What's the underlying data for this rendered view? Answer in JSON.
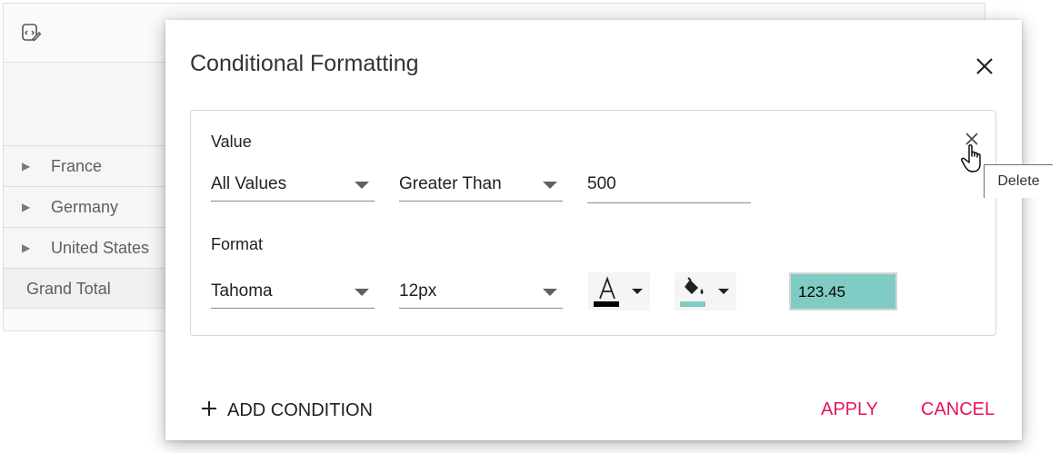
{
  "pivot": {
    "rows": [
      {
        "label": "France"
      },
      {
        "label": "Germany"
      },
      {
        "label": "United States"
      }
    ],
    "grand_total": "Grand Total"
  },
  "dialog": {
    "title": "Conditional Formatting",
    "condition": {
      "value_label": "Value",
      "measure": "All Values",
      "operator": "Greater Than",
      "value": "500",
      "format_label": "Format",
      "font_family": "Tahoma",
      "font_size": "12px",
      "font_color": "#000000",
      "background_color": "#80cbc4",
      "preview_text": "123.45",
      "delete_tooltip": "Delete"
    },
    "add_condition": "ADD CONDITION",
    "apply": "APPLY",
    "cancel": "CANCEL"
  },
  "icons": {
    "toolbar": "formatting-icon",
    "close": "close-icon",
    "delete": "close-icon",
    "font_color": "font-color-icon",
    "fill": "paint-bucket-icon",
    "add": "plus-icon",
    "expand": "caret-right-icon",
    "cursor": "hand-pointer-icon"
  },
  "colors": {
    "accent": "#e3165b",
    "text": "#212121"
  }
}
